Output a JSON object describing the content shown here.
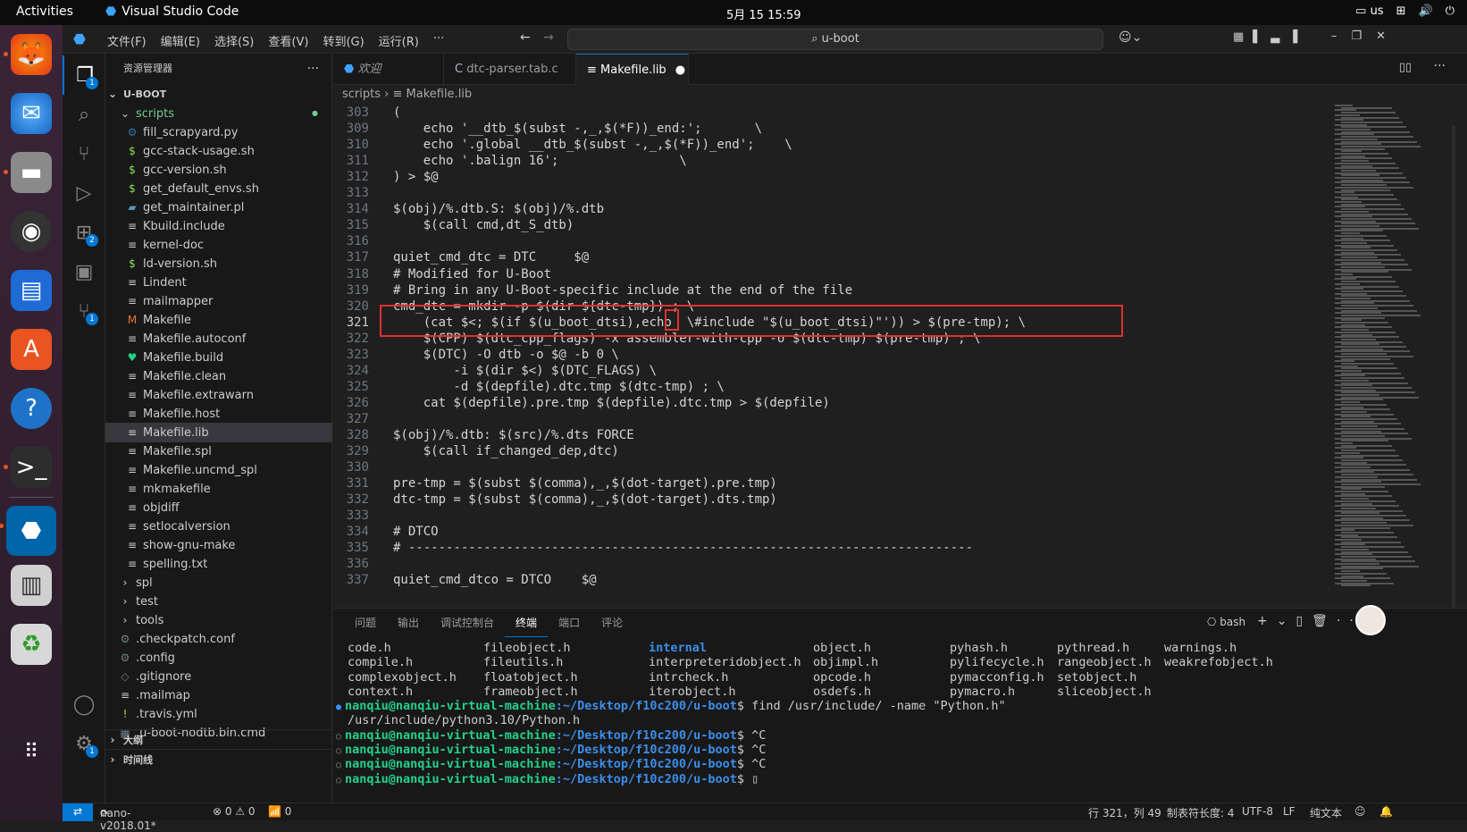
{
  "os": {
    "activities": "Activities",
    "app_name": "Visual Studio Code",
    "clock": "5月 15  15:59",
    "keyboard": "us"
  },
  "menu": [
    "文件(F)",
    "编辑(E)",
    "选择(S)",
    "查看(V)",
    "转到(G)",
    "运行(R)",
    "···"
  ],
  "search": {
    "text": "u-boot"
  },
  "explorer": {
    "title": "资源管理器",
    "more": "···",
    "root": "U-BOOT",
    "items": [
      {
        "label": "scripts",
        "icon": "folder-open",
        "depth": 1,
        "type": "folder"
      },
      {
        "label": "fill_scrapyard.py",
        "icon": "py",
        "depth": 2
      },
      {
        "label": "gcc-stack-usage.sh",
        "icon": "$",
        "depth": 2
      },
      {
        "label": "gcc-version.sh",
        "icon": "$",
        "depth": 2
      },
      {
        "label": "get_default_envs.sh",
        "icon": "$",
        "depth": 2
      },
      {
        "label": "get_maintainer.pl",
        "icon": "pl",
        "depth": 2
      },
      {
        "label": "Kbuild.include",
        "icon": "≡",
        "depth": 2
      },
      {
        "label": "kernel-doc",
        "icon": "≡",
        "depth": 2
      },
      {
        "label": "ld-version.sh",
        "icon": "$",
        "depth": 2
      },
      {
        "label": "Lindent",
        "icon": "≡",
        "depth": 2
      },
      {
        "label": "mailmapper",
        "icon": "≡",
        "depth": 2
      },
      {
        "label": "Makefile",
        "icon": "M",
        "depth": 2
      },
      {
        "label": "Makefile.autoconf",
        "icon": "≡",
        "depth": 2
      },
      {
        "label": "Makefile.build",
        "icon": "♥",
        "depth": 2
      },
      {
        "label": "Makefile.clean",
        "icon": "≡",
        "depth": 2
      },
      {
        "label": "Makefile.extrawarn",
        "icon": "≡",
        "depth": 2
      },
      {
        "label": "Makefile.host",
        "icon": "≡",
        "depth": 2
      },
      {
        "label": "Makefile.lib",
        "icon": "≡",
        "depth": 2,
        "selected": true
      },
      {
        "label": "Makefile.spl",
        "icon": "≡",
        "depth": 2
      },
      {
        "label": "Makefile.uncmd_spl",
        "icon": "≡",
        "depth": 2
      },
      {
        "label": "mkmakefile",
        "icon": "≡",
        "depth": 2
      },
      {
        "label": "objdiff",
        "icon": "≡",
        "depth": 2
      },
      {
        "label": "setlocalversion",
        "icon": "≡",
        "depth": 2
      },
      {
        "label": "show-gnu-make",
        "icon": "≡",
        "depth": 2
      },
      {
        "label": "spelling.txt",
        "icon": "≡",
        "depth": 2
      },
      {
        "label": "spl",
        "icon": "›",
        "depth": 1
      },
      {
        "label": "test",
        "icon": "›",
        "depth": 1
      },
      {
        "label": "tools",
        "icon": "›",
        "depth": 1
      },
      {
        "label": ".checkpatch.conf",
        "icon": "⚙",
        "depth": 1
      },
      {
        "label": ".config",
        "icon": "⚙",
        "depth": 1
      },
      {
        "label": ".gitignore",
        "icon": "◇",
        "depth": 1
      },
      {
        "label": ".mailmap",
        "icon": "≡",
        "depth": 1
      },
      {
        "label": ".travis.yml",
        "icon": "!",
        "depth": 1
      },
      {
        "label": ".u-boot-nodtb.bin.cmd",
        "icon": "▦",
        "depth": 1
      }
    ],
    "outline": "大纲",
    "timeline": "时间线"
  },
  "tabs": [
    {
      "label": "欢迎",
      "icon": "vscode"
    },
    {
      "label": "dtc-parser.tab.c",
      "icon": "C"
    },
    {
      "label": "Makefile.lib",
      "icon": "≡",
      "active": true,
      "modified": true
    }
  ],
  "breadcrumb": {
    "folder": "scripts",
    "file": "Makefile.lib"
  },
  "code": [
    {
      "n": "303",
      "t": "("
    },
    {
      "n": "309",
      "t": "    echo '__dtb_$(subst -,_,$(*F))_end:';       \\"
    },
    {
      "n": "310",
      "t": "    echo '.global __dtb_$(subst -,_,$(*F))_end';    \\"
    },
    {
      "n": "311",
      "t": "    echo '.balign 16';                \\"
    },
    {
      "n": "312",
      "t": ") > $@"
    },
    {
      "n": "313",
      "t": ""
    },
    {
      "n": "314",
      "t": "$(obj)/%.dtb.S: $(obj)/%.dtb"
    },
    {
      "n": "315",
      "t": "    $(call cmd,dt_S_dtb)"
    },
    {
      "n": "316",
      "t": ""
    },
    {
      "n": "317",
      "t": "quiet_cmd_dtc = DTC     $@"
    },
    {
      "n": "318",
      "t": "# Modified for U-Boot"
    },
    {
      "n": "319",
      "t": "# Bring in any U-Boot-specific include at the end of the file"
    },
    {
      "n": "320",
      "t": "cmd_dtc = mkdir -p $(dir ${dtc-tmp}) ; \\"
    },
    {
      "n": "321",
      "t": "    (cat $<; $(if $(u_boot_dtsi),echo  \\#include \"$(u_boot_dtsi)\"')) > $(pre-tmp); \\",
      "cur": true
    },
    {
      "n": "322",
      "t": "    $(CPP) $(dtc_cpp_flags) -x assembler-with-cpp -o $(dtc-tmp) $(pre-tmp) ; \\"
    },
    {
      "n": "323",
      "t": "    $(DTC) -O dtb -o $@ -b 0 \\"
    },
    {
      "n": "324",
      "t": "        -i $(dir $<) $(DTC_FLAGS) \\"
    },
    {
      "n": "325",
      "t": "        -d $(depfile).dtc.tmp $(dtc-tmp) ; \\"
    },
    {
      "n": "326",
      "t": "    cat $(depfile).pre.tmp $(depfile).dtc.tmp > $(depfile)"
    },
    {
      "n": "327",
      "t": ""
    },
    {
      "n": "328",
      "t": "$(obj)/%.dtb: $(src)/%.dts FORCE"
    },
    {
      "n": "329",
      "t": "    $(call if_changed_dep,dtc)"
    },
    {
      "n": "330",
      "t": ""
    },
    {
      "n": "331",
      "t": "pre-tmp = $(subst $(comma),_,$(dot-target).pre.tmp)"
    },
    {
      "n": "332",
      "t": "dtc-tmp = $(subst $(comma),_,$(dot-target).dts.tmp)"
    },
    {
      "n": "333",
      "t": ""
    },
    {
      "n": "334",
      "t": "# DTCO"
    },
    {
      "n": "335",
      "t": "# ---------------------------------------------------------------------------"
    },
    {
      "n": "336",
      "t": ""
    },
    {
      "n": "337",
      "t": "quiet_cmd_dtco = DTCO    $@"
    }
  ],
  "panel": {
    "tabs": [
      "问题",
      "输出",
      "调试控制台",
      "终端",
      "端口",
      "评论"
    ],
    "active": "终端",
    "shell": "bash"
  },
  "terminal": {
    "grid": [
      [
        "code.h",
        "fileobject.h",
        "internal",
        "object.h",
        "pyhash.h",
        "pythread.h",
        "warnings.h"
      ],
      [
        "compile.h",
        "fileutils.h",
        "interpreteridobject.h",
        "objimpl.h",
        "pylifecycle.h",
        "rangeobject.h",
        "weakrefobject.h"
      ],
      [
        "complexobject.h",
        "floatobject.h",
        "intrcheck.h",
        "opcode.h",
        "pymacconfig.h",
        "setobject.h",
        ""
      ],
      [
        "context.h",
        "frameobject.h",
        "iterobject.h",
        "osdefs.h",
        "pymacro.h",
        "sliceobject.h",
        ""
      ]
    ],
    "user": "nanqiu@nanqiu-virtual-machine",
    "path": ":~/Desktop/f10c200/u-boot",
    "lines": [
      {
        "cmd": "$ find /usr/include/ -name \"Python.h\"",
        "dot": "b"
      },
      {
        "out": "/usr/include/python3.10/Python.h"
      },
      {
        "cmd": "$ ^C",
        "dot": "o"
      },
      {
        "cmd": "$ ^C",
        "dot": "o"
      },
      {
        "cmd": "$ ^C",
        "dot": "o"
      },
      {
        "cmd": "$ ▯",
        "dot": "o"
      }
    ]
  },
  "status": {
    "branch": "nano-v2018.01*",
    "errors": "⊗ 0 ⚠ 0",
    "ports": "📶 0",
    "position": "行 321，列 49",
    "tab": "制表符长度: 4",
    "encoding": "UTF-8",
    "eol": "LF",
    "lang": "纯文本"
  }
}
